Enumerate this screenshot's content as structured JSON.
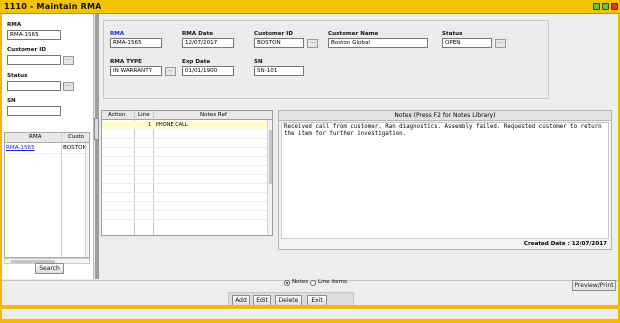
{
  "window": {
    "title": "1110 - Maintain RMA"
  },
  "search_pane": {
    "rma_label": "RMA",
    "rma_value": "RMA-1565",
    "customer_id_label": "Customer ID",
    "customer_id_value": "",
    "status_label": "Status",
    "status_value": "",
    "sn_label": "SN",
    "sn_value": "",
    "lookup_label": "...",
    "grid": {
      "columns": [
        "RMA",
        "Custo"
      ],
      "rows": [
        {
          "rma": "RMA-1565",
          "customer": "BOSTON"
        }
      ]
    },
    "search_button": "Search"
  },
  "header": {
    "rma_label": "RMA",
    "rma_value": "RMA-1565",
    "rma_date_label": "RMA Date",
    "rma_date_value": "12/07/2017",
    "customer_id_label": "Customer ID",
    "customer_id_value": "BOSTON",
    "customer_name_label": "Customer Name",
    "customer_name_value": "Boston Global",
    "status_label": "Status",
    "status_value": "OPEN",
    "rma_type_label": "RMA TYPE",
    "rma_type_value": "IN WARRANTY",
    "exp_date_label": "Exp Date",
    "exp_date_value": "01/01/1900",
    "sn_label": "SN",
    "sn_value": "SN-101",
    "lookup_label": "..."
  },
  "actions_grid": {
    "columns": [
      "Action",
      "Line",
      "Notes Ref"
    ],
    "rows": [
      {
        "action": "",
        "line": "1",
        "notes_ref": "PHONE CALL"
      }
    ]
  },
  "notes": {
    "header": "Notes (Press F2 for Notes Library)",
    "text": "Received call from customer. Ran diagnostics. Assembly failed. Requested customer to return the item for further investigation.",
    "created_date": "Created Date : 12/07/2017"
  },
  "view_toggle": {
    "options": [
      "Notes",
      "Line items"
    ],
    "selected": "Notes"
  },
  "toolbar": {
    "preview_print": "Preview/Print",
    "add": "Add",
    "edit": "Edit",
    "delete": "Delete",
    "exit": "Exit"
  },
  "colors": {
    "title_bar": "#f3c200",
    "link_blue": "#0a2fd5",
    "selected_row": "#fffdd0"
  }
}
